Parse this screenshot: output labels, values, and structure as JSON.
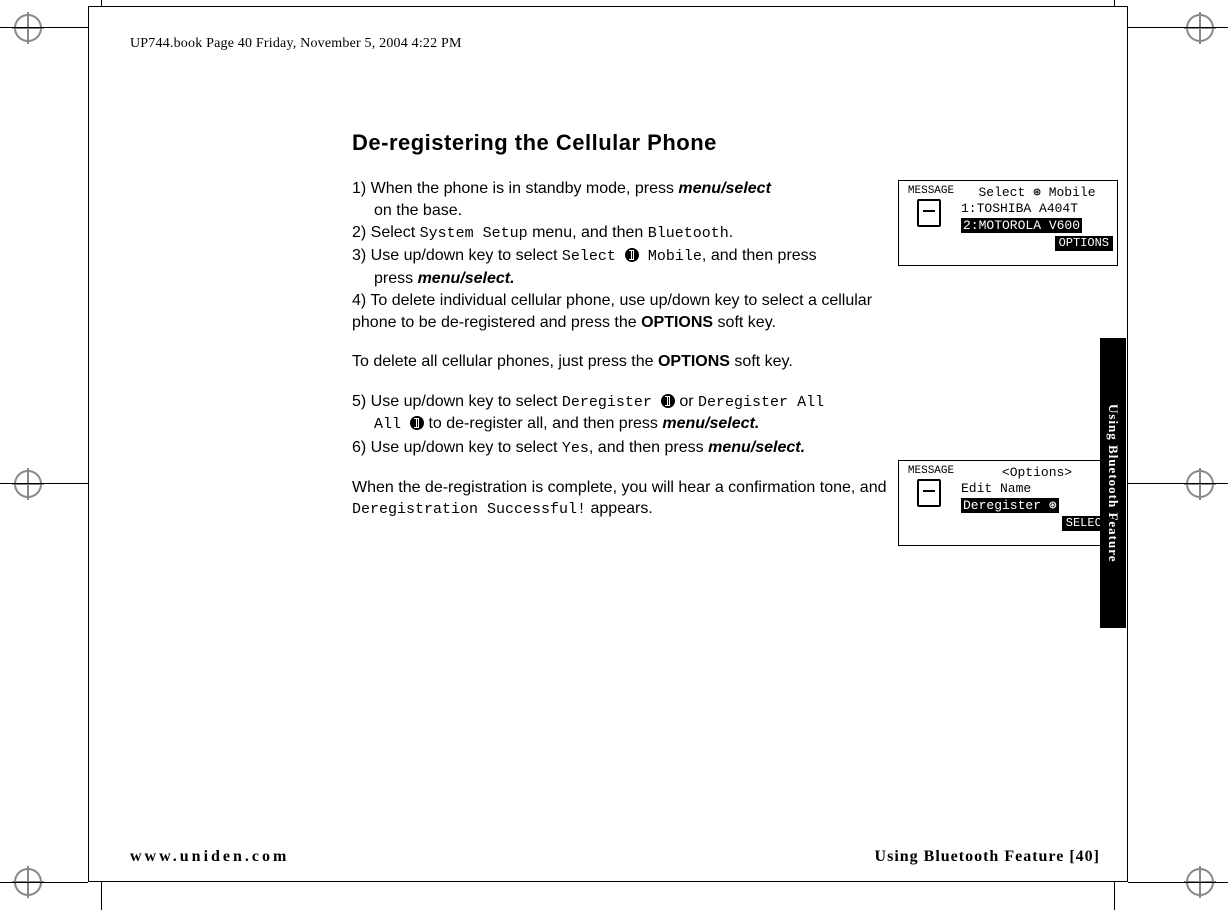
{
  "header": {
    "runner": "UP744.book  Page 40  Friday, November 5, 2004  4:22 PM"
  },
  "section": {
    "title": "De-registering the Cellular Phone"
  },
  "steps": {
    "s1a": "1) When the phone is in standby mode, press ",
    "s1b": "menu/select",
    "s1c": " on the base.",
    "s2a": "2) Select ",
    "s2b": "System Setup",
    "s2c": " menu, and then ",
    "s2d": "Bluetooth",
    "s2e": ".",
    "s3a": "3) Use up/down key to select ",
    "s3b": "Select ",
    "s3c": " Mobile",
    "s3d": ", and then press ",
    "s3e": "menu/select.",
    "s4a": "4) To delete individual cellular phone, use up/down key to select a cellular phone to be de-registered and press the ",
    "s4b": "OPTIONS",
    "s4c": " soft key.",
    "mid": "To delete all cellular phones, just press the ",
    "midb": "OPTIONS",
    "midc": " soft key.",
    "s5a": "5) Use up/down key to select ",
    "s5b": "Deregister ",
    "s5c": " or ",
    "s5d": "Deregister All ",
    "s5e": " to de-register all, and then press ",
    "s5f": "menu/select.",
    "s6a": "6) Use up/down key to select ",
    "s6b": "Yes",
    "s6c": ", and then press ",
    "s6d": "menu/select.",
    "end1": "When the de-registration is complete, you will hear a confirmation tone, and ",
    "end2": "Deregistration Successful!",
    "end3": " appears."
  },
  "lcd1": {
    "message_label": "MESSAGE",
    "line1": "Select ⊛ Mobile",
    "line2": "1:TOSHIBA A404T",
    "line3": "2:MOTOROLA V600",
    "softkey": "OPTIONS"
  },
  "lcd2": {
    "message_label": "MESSAGE",
    "line1": "<Options>",
    "line2": "Edit Name",
    "line3": "Deregister ⊛",
    "softkey": "SELECT"
  },
  "side_tab": "Using Bluetooth Feature",
  "footer": {
    "url": "www.uniden.com",
    "right": "Using Bluetooth Feature [40]"
  }
}
